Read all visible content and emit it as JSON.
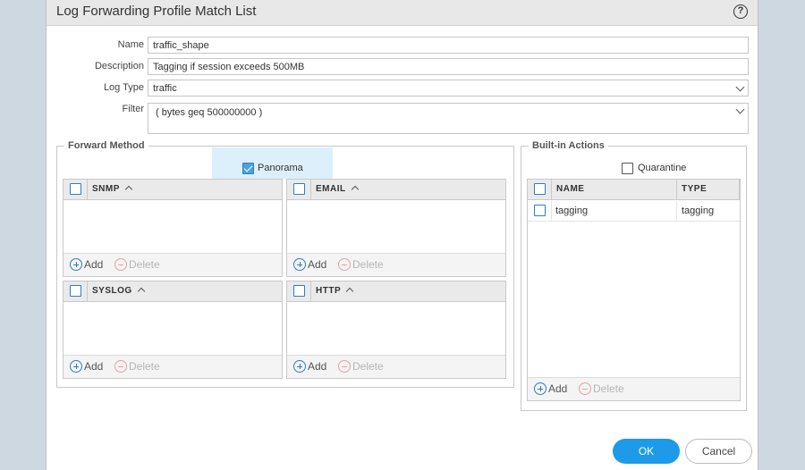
{
  "dialog": {
    "title": "Log Forwarding Profile Match List",
    "help_glyph": "?"
  },
  "form": {
    "name": {
      "label": "Name",
      "value": "traffic_shape"
    },
    "description": {
      "label": "Description",
      "value": "Tagging if session exceeds 500MB"
    },
    "log_type": {
      "label": "Log Type",
      "value": "traffic"
    },
    "filter": {
      "label": "Filter",
      "value": "( bytes geq 500000000 )"
    }
  },
  "forward_method": {
    "legend": "Forward Method",
    "panorama": {
      "label": "Panorama",
      "checked": true
    },
    "panels": [
      {
        "header": "SNMP"
      },
      {
        "header": "EMAIL"
      },
      {
        "header": "SYSLOG"
      },
      {
        "header": "HTTP"
      }
    ]
  },
  "builtin_actions": {
    "legend": "Built-in Actions",
    "quarantine": {
      "label": "Quarantine",
      "checked": false
    },
    "columns": [
      "NAME",
      "TYPE"
    ],
    "rows": [
      {
        "name": "tagging",
        "type": "tagging"
      }
    ]
  },
  "actions": {
    "add": "Add",
    "delete": "Delete"
  },
  "buttons": {
    "ok": "OK",
    "cancel": "Cancel"
  },
  "colors": {
    "accent": "#1e9be8",
    "checkbox": "#2f7fb5",
    "panorama_highlight": "#dcf0fb"
  }
}
